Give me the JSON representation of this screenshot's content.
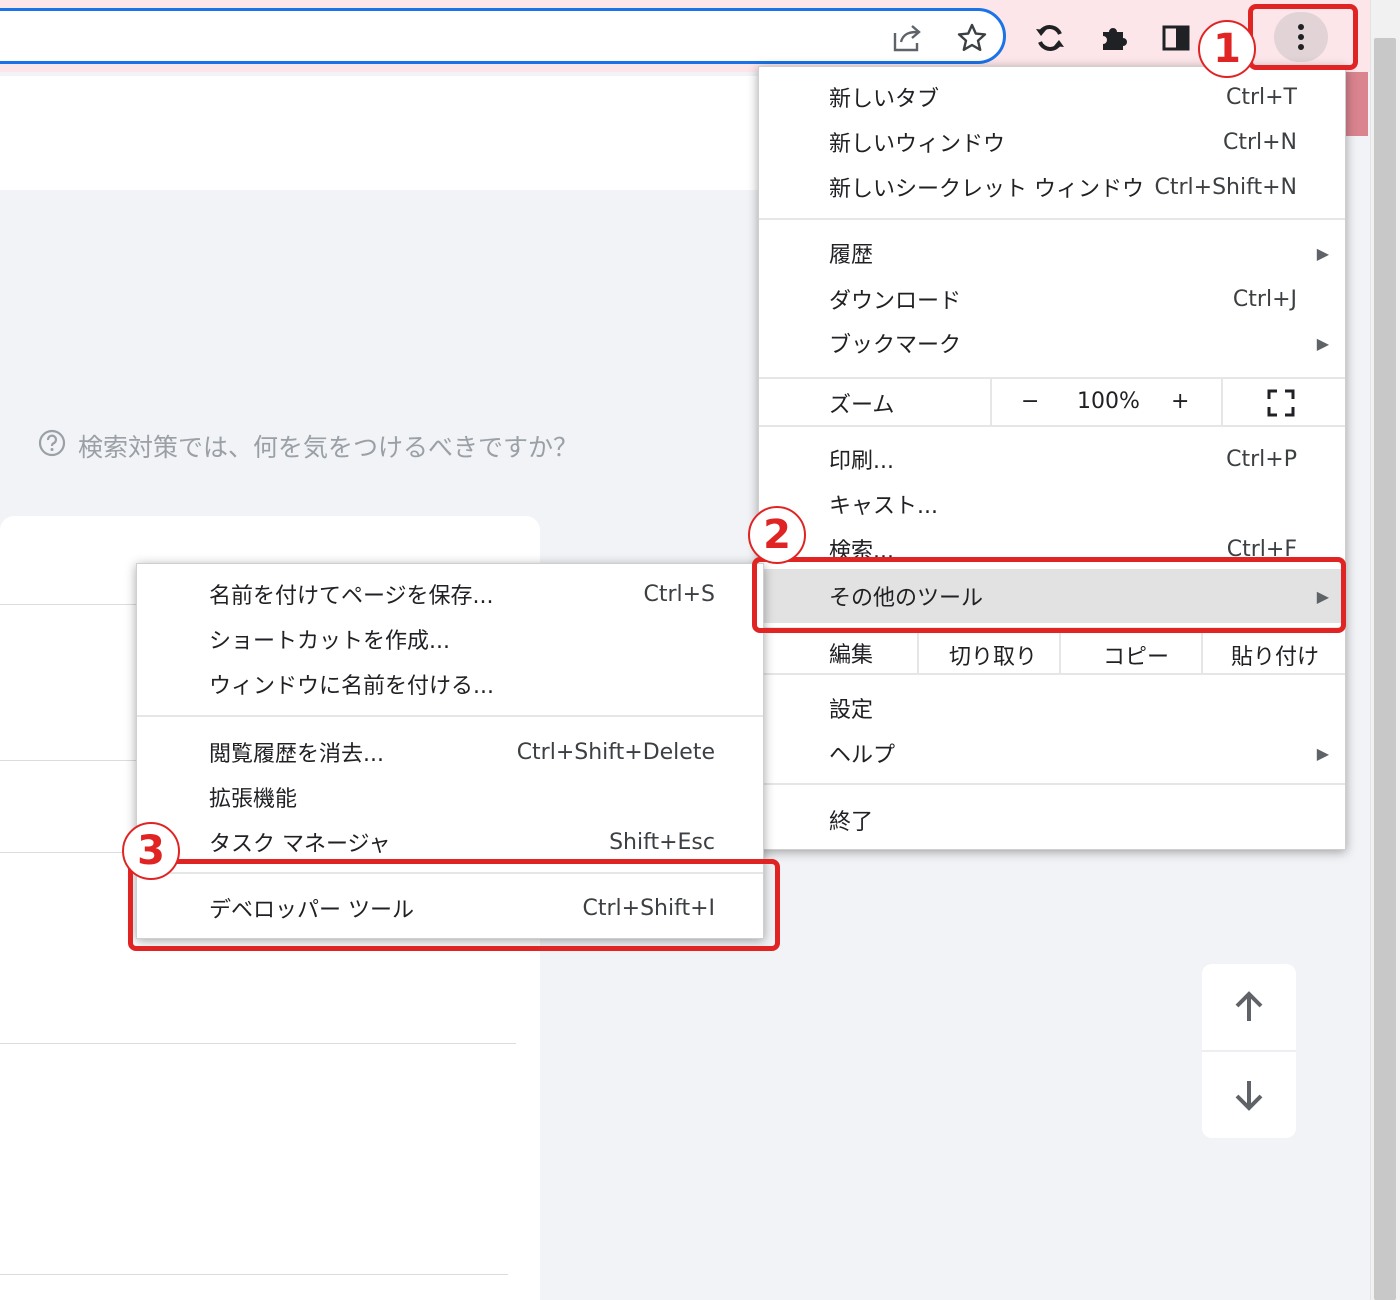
{
  "browser": {
    "icons": [
      "share-icon",
      "star-icon",
      "sync-icon",
      "extensions-icon",
      "side-panel-icon",
      "more-vert-icon"
    ]
  },
  "page": {
    "question": "検索対策では、何を気をつけるべきですか？",
    "question_icon": "help-circle-icon"
  },
  "main_menu": {
    "new_tab": {
      "label": "新しいタブ",
      "shortcut": "Ctrl+T"
    },
    "new_window": {
      "label": "新しいウィンドウ",
      "shortcut": "Ctrl+N"
    },
    "new_incognito": {
      "label": "新しいシークレット ウィンドウ",
      "shortcut": "Ctrl+Shift+N"
    },
    "history": {
      "label": "履歴"
    },
    "downloads": {
      "label": "ダウンロード",
      "shortcut": "Ctrl+J"
    },
    "bookmarks": {
      "label": "ブックマーク"
    },
    "zoom": {
      "label": "ズーム",
      "minus": "−",
      "value": "100%",
      "plus": "+"
    },
    "print": {
      "label": "印刷...",
      "shortcut": "Ctrl+P"
    },
    "cast": {
      "label": "キャスト..."
    },
    "find": {
      "label": "検索...",
      "shortcut": "Ctrl+F"
    },
    "more_tools": {
      "label": "その他のツール"
    },
    "edit": {
      "label": "編集",
      "cut": "切り取り",
      "copy": "コピー",
      "paste": "貼り付け"
    },
    "settings": {
      "label": "設定"
    },
    "help": {
      "label": "ヘルプ"
    },
    "exit": {
      "label": "終了"
    }
  },
  "sub_menu": {
    "save_page": {
      "label": "名前を付けてページを保存...",
      "shortcut": "Ctrl+S"
    },
    "create_shortcut": {
      "label": "ショートカットを作成..."
    },
    "name_window": {
      "label": "ウィンドウに名前を付ける..."
    },
    "clear_data": {
      "label": "閲覧履歴を消去...",
      "shortcut": "Ctrl+Shift+Delete"
    },
    "extensions": {
      "label": "拡張機能"
    },
    "task_manager": {
      "label": "タスク マネージャ",
      "shortcut": "Shift+Esc"
    },
    "dev_tools": {
      "label": "デベロッパー ツール",
      "shortcut": "Ctrl+Shift+I"
    }
  },
  "annotations": {
    "step1": "1",
    "step2": "2",
    "step3": "3",
    "color": "#e02424"
  }
}
